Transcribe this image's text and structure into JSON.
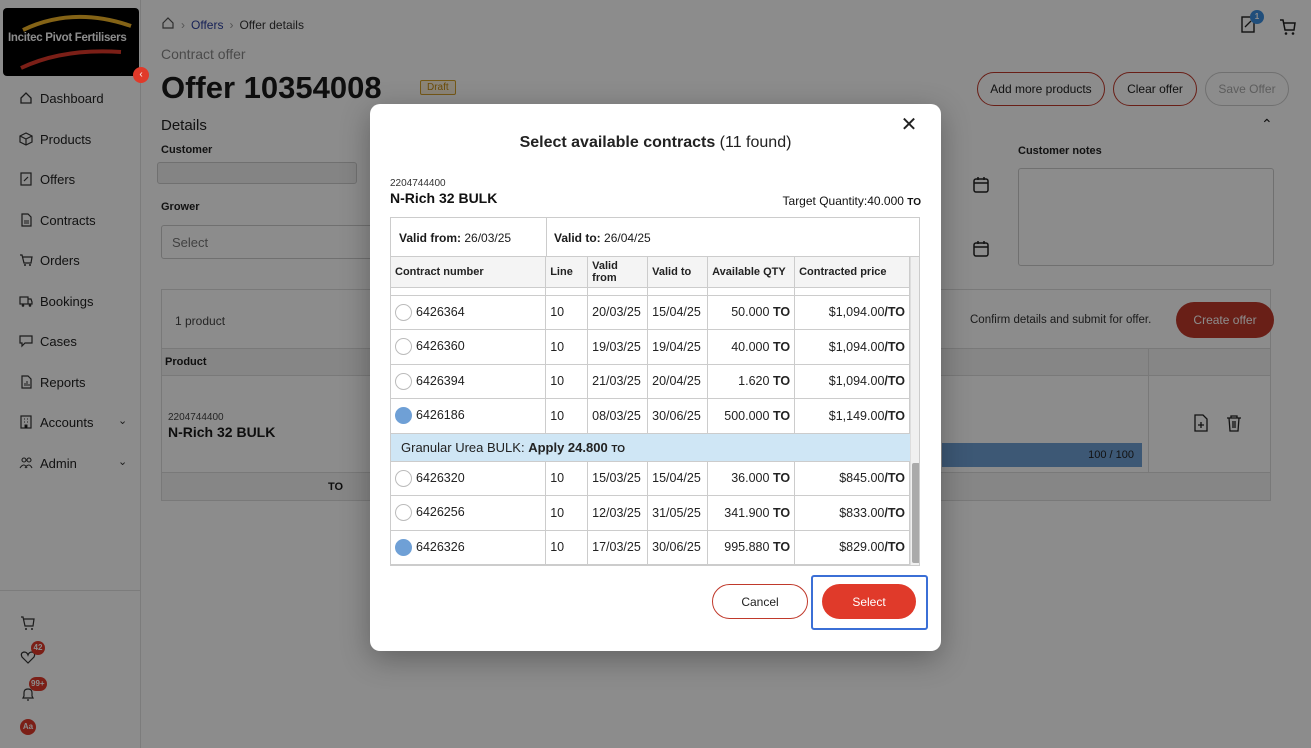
{
  "brand": {
    "logo_text": "Incitec Pivot Fertilisers",
    "accent": "#e03a2a",
    "primary_button": "#c0392b"
  },
  "sidebar": {
    "items": [
      {
        "label": "Dashboard",
        "icon": "home-icon"
      },
      {
        "label": "Products",
        "icon": "cube-icon"
      },
      {
        "label": "Offers",
        "icon": "offer-icon"
      },
      {
        "label": "Contracts",
        "icon": "document-icon"
      },
      {
        "label": "Orders",
        "icon": "cart-icon"
      },
      {
        "label": "Bookings",
        "icon": "truck-icon"
      },
      {
        "label": "Cases",
        "icon": "chat-icon"
      },
      {
        "label": "Reports",
        "icon": "report-icon"
      },
      {
        "label": "Accounts",
        "icon": "building-icon"
      },
      {
        "label": "Admin",
        "icon": "people-icon"
      }
    ],
    "favorites_count": "42",
    "notifications_count": "99+",
    "user_initials": "Aa"
  },
  "header": {
    "offers_badge": "1"
  },
  "breadcrumb": {
    "offers": "Offers",
    "current": "Offer details"
  },
  "page": {
    "subtitle": "Contract offer",
    "title": "Offer 10354008",
    "status": "Draft",
    "add_more": "Add more products",
    "clear": "Clear offer",
    "save": "Save Offer",
    "details": "Details",
    "customer_label": "Customer",
    "grower_label": "Grower",
    "grower_placeholder": "Select",
    "customer_notes_label": "Customer notes",
    "product_count": "1 product",
    "confirm_text": "Confirm details and submit for offer.",
    "create_offer": "Create offer",
    "product_header": "Product",
    "row_code": "2204744400",
    "row_name": "N-Rich 32 BULK",
    "progress": "100 / 100",
    "footer_to": "TO"
  },
  "modal": {
    "title": "Select available contracts",
    "found": "(11 found)",
    "product_code": "2204744400",
    "product_name": "N-Rich 32 BULK",
    "target_label": "Target Quantity:",
    "target_value": "40.000",
    "target_unit": "TO",
    "valid_from_label": "Valid from:",
    "valid_from": "26/03/25",
    "valid_to_label": "Valid to:",
    "valid_to": "26/04/25",
    "columns": [
      "Contract number",
      "Line",
      "Valid from",
      "Valid to",
      "Available QTY",
      "Contracted price"
    ],
    "rows_a": [
      {
        "contract": "6426364",
        "line": "10",
        "from": "20/03/25",
        "to": "15/04/25",
        "qty": "50.000",
        "price": "$1,094.00",
        "checked": false
      },
      {
        "contract": "6426360",
        "line": "10",
        "from": "19/03/25",
        "to": "19/04/25",
        "qty": "40.000",
        "price": "$1,094.00",
        "checked": false
      },
      {
        "contract": "6426394",
        "line": "10",
        "from": "21/03/25",
        "to": "20/04/25",
        "qty": "1.620",
        "price": "$1,094.00",
        "checked": false
      },
      {
        "contract": "6426186",
        "line": "10",
        "from": "08/03/25",
        "to": "30/06/25",
        "qty": "500.000",
        "price": "$1,149.00",
        "checked": true
      }
    ],
    "group_label": "Granular Urea BULK:",
    "group_apply": "Apply 24.800",
    "group_unit": "TO",
    "rows_b": [
      {
        "contract": "6426320",
        "line": "10",
        "from": "15/03/25",
        "to": "15/04/25",
        "qty": "36.000",
        "price": "$845.00",
        "checked": false
      },
      {
        "contract": "6426256",
        "line": "10",
        "from": "12/03/25",
        "to": "31/05/25",
        "qty": "341.900",
        "price": "$833.00",
        "checked": false
      },
      {
        "contract": "6426326",
        "line": "10",
        "from": "17/03/25",
        "to": "30/06/25",
        "qty": "995.880",
        "price": "$829.00",
        "checked": true
      }
    ],
    "unit": "TO",
    "price_unit": "/TO",
    "cancel": "Cancel",
    "select": "Select"
  }
}
